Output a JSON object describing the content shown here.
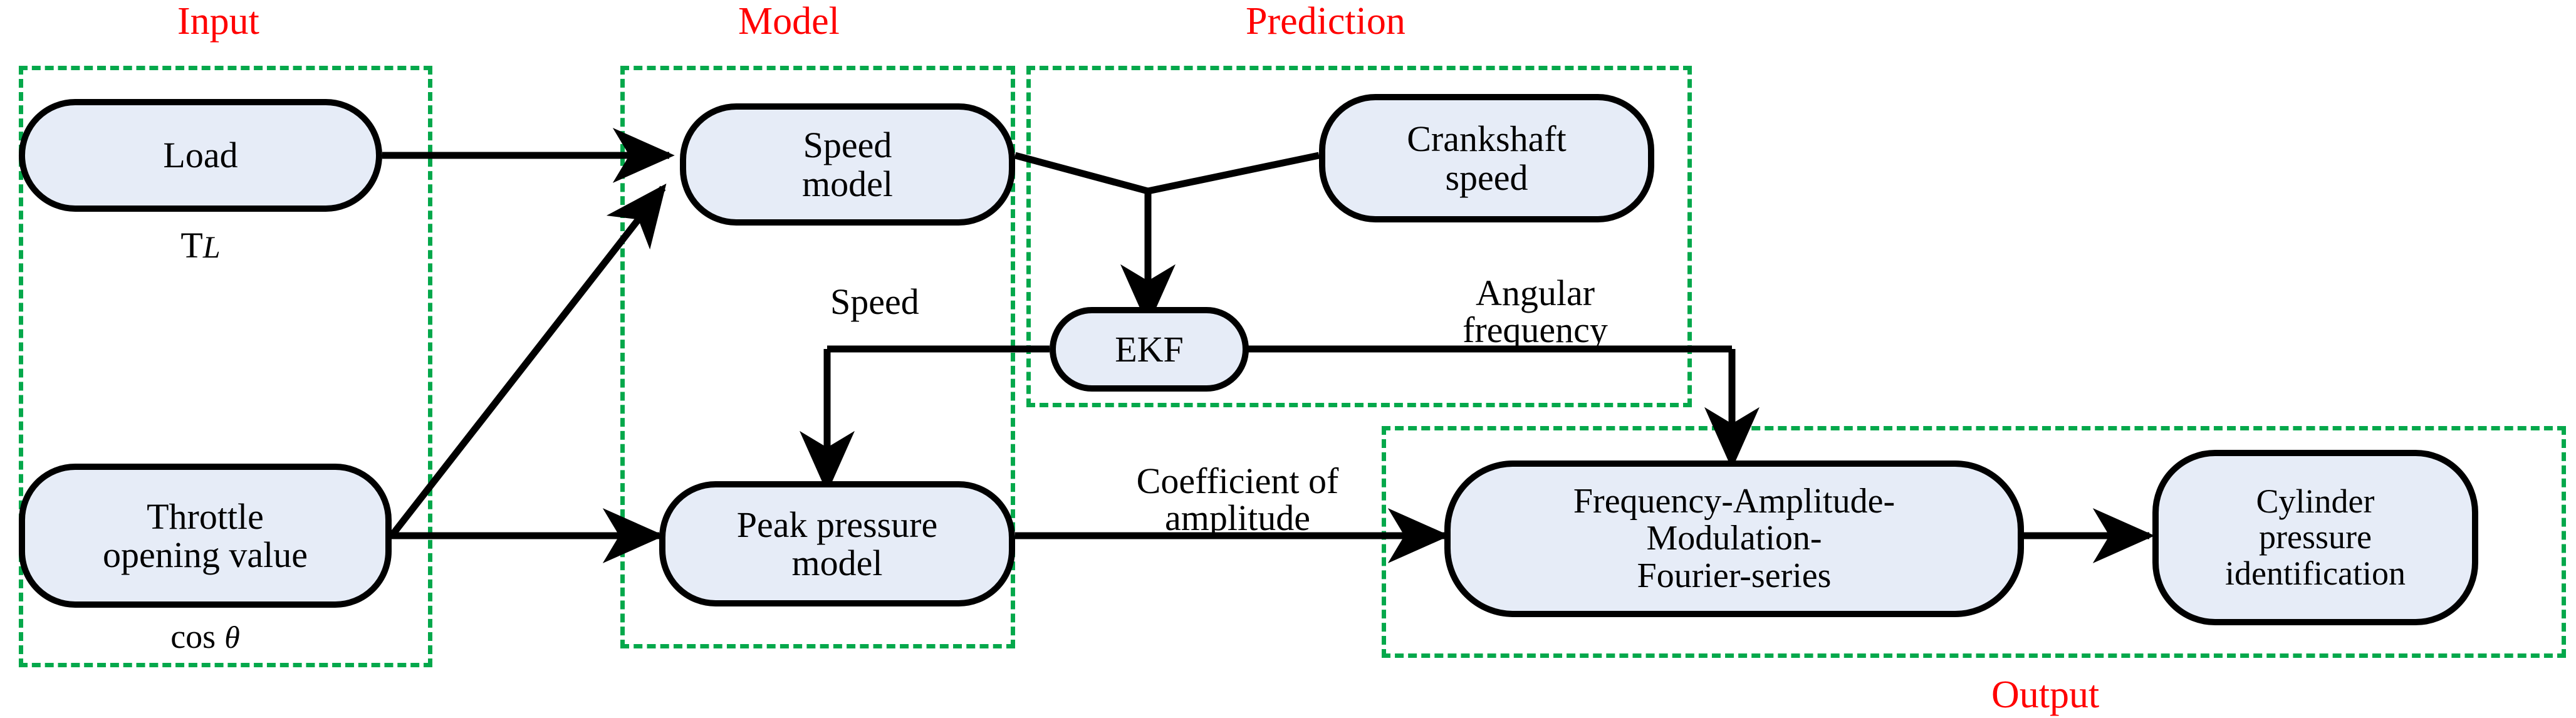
{
  "diagram": {
    "title_color": "#ff0000",
    "group_border_color": "#04a84b",
    "node_fill_color": "#e6ecf7",
    "node_border_color": "#000000",
    "groups": [
      {
        "id": "input",
        "label": "Input"
      },
      {
        "id": "model",
        "label": "Model"
      },
      {
        "id": "prediction",
        "label": "Prediction"
      },
      {
        "id": "output",
        "label": "Output"
      }
    ],
    "nodes": [
      {
        "id": "load",
        "label": "Load"
      },
      {
        "id": "throttle",
        "label": "Throttle\nopening value"
      },
      {
        "id": "speed_model",
        "label": "Speed\nmodel"
      },
      {
        "id": "peak_model",
        "label": "Peak pressure\nmodel"
      },
      {
        "id": "crankshaft",
        "label": "Crankshaft\nspeed"
      },
      {
        "id": "ekf",
        "label": "EKF"
      },
      {
        "id": "famfs",
        "label": "Frequency-Amplitude-\nModulation-\nFourier-series"
      },
      {
        "id": "cylinder",
        "label": "Cylinder\npressure\nidentification"
      }
    ],
    "annotations": [
      {
        "id": "load_sub",
        "text_main": "T",
        "text_sub": "L"
      },
      {
        "id": "throttle_sub",
        "text_main": "cos",
        "text_sub": "θ"
      }
    ],
    "edge_labels": [
      {
        "id": "speed",
        "text": "Speed"
      },
      {
        "id": "angular",
        "text": "Angular\nfrequency"
      },
      {
        "id": "coefficient",
        "text": "Coefficient of\namplitude"
      }
    ]
  }
}
